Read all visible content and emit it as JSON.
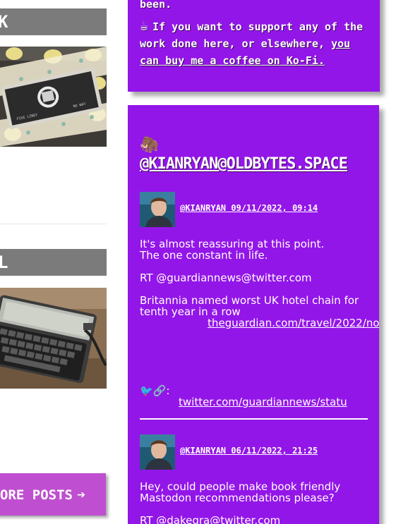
{
  "left": {
    "posts": [
      {
        "title": "K"
      },
      {
        "title": "L"
      }
    ],
    "more_posts": {
      "label": "ORE POSTS",
      "arrow": "➔"
    }
  },
  "kofi": {
    "top_fragment": "been.",
    "cup": "☕",
    "text": "If you want to support any of the work done here, or elsewhere,",
    "link_text": "you can buy me a coffee on Ko-Fi."
  },
  "mastodon": {
    "emoji": "🦣",
    "handle": "@KIANRYAN@OLDBYTES.SPACE",
    "toots": [
      {
        "meta": "@KIANRYAN 09/11/2022, 09:14",
        "p1_line1": "It's almost reassuring at this point.",
        "p1_line2": "The one constant in life.",
        "p2": "RT @guardiannews@twitter.com",
        "p3_line1": "Britannia named worst UK hotel chain for",
        "p3_line2": "tenth year in a row",
        "link1": "theguardian.com/travel/2022/no",
        "emojis": "🐦🔗:",
        "link2": "twitter.com/guardiannews/statu"
      },
      {
        "meta": "@KIANRYAN 06/11/2022, 21:25",
        "p1_line1": "Hey, could people make book friendly",
        "p1_line2": "Mastodon recommendations please?",
        "p2": "RT @dakegra@twitter.com"
      }
    ]
  },
  "colors": {
    "purple": "#9316e8",
    "grey_bar": "#7b7b7b",
    "more_posts": "#bf4fd0"
  }
}
